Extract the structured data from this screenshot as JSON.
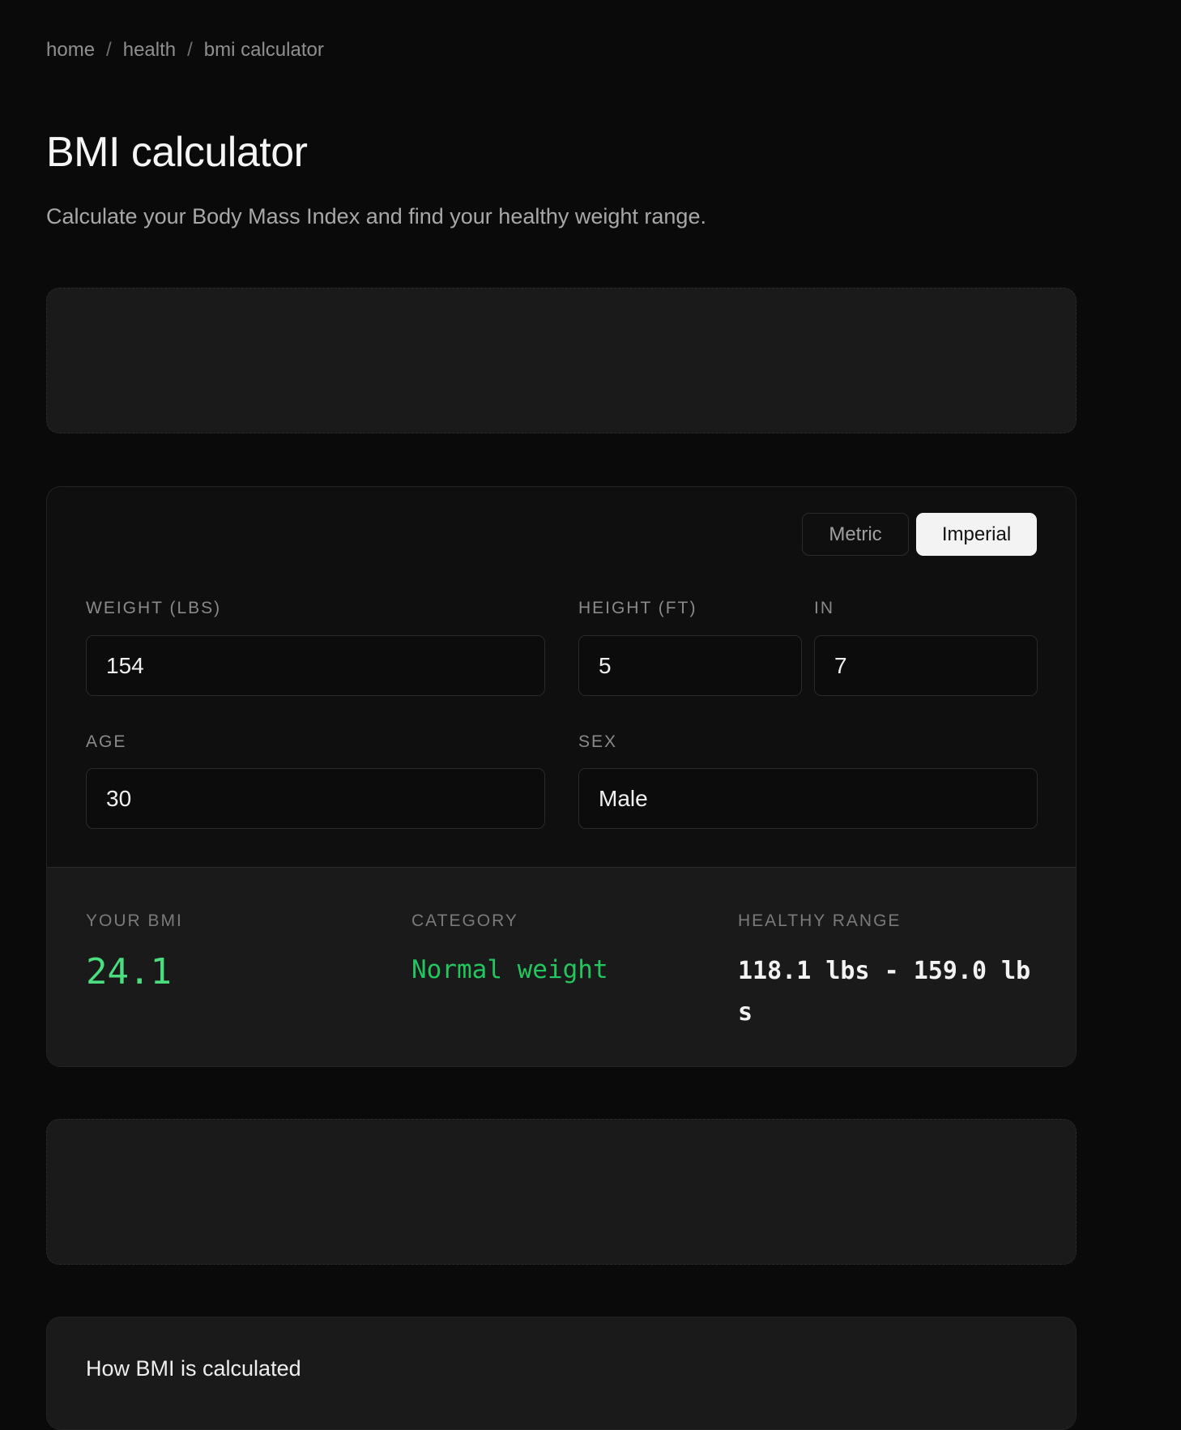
{
  "breadcrumb": {
    "items": [
      "home",
      "health",
      "bmi calculator"
    ],
    "separator": "/"
  },
  "header": {
    "title": "BMI calculator",
    "subtitle": "Calculate your Body Mass Index and find your healthy weight range."
  },
  "units": {
    "options": [
      "Metric",
      "Imperial"
    ],
    "selected": "Imperial"
  },
  "form": {
    "weight": {
      "label": "WEIGHT (LBS)",
      "value": "154"
    },
    "height_ft": {
      "label": "HEIGHT (FT)",
      "value": "5"
    },
    "height_in": {
      "label": "IN",
      "value": "7"
    },
    "age": {
      "label": "AGE",
      "value": "30"
    },
    "sex": {
      "label": "SEX",
      "value": "Male"
    }
  },
  "results": {
    "bmi_label": "YOUR BMI",
    "bmi_value": "24.1",
    "category_label": "CATEGORY",
    "category_value": "Normal weight",
    "range_label": "HEALTHY RANGE",
    "range_value": "118.1 lbs - 159.0 lbs"
  },
  "info": {
    "title": "How BMI is calculated"
  },
  "colors": {
    "background": "#0a0a0a",
    "card": "#1a1a1a",
    "accent_green": "#4ade80",
    "category_green": "#22c55e",
    "toggle_active": "#f3f3f3"
  }
}
